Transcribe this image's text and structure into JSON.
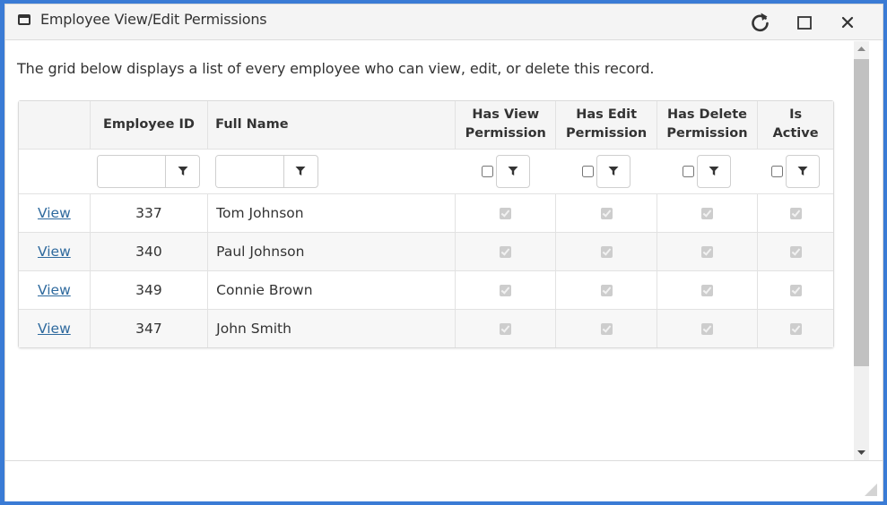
{
  "window": {
    "title": "Employee View/Edit Permissions",
    "icon": "window-icon",
    "controls": {
      "refresh": "refresh-icon",
      "maximize": "maximize-icon",
      "close": "close-icon"
    }
  },
  "intro_text": "The grid below displays a list of every employee who can view, edit, or delete this record.",
  "grid": {
    "columns": [
      {
        "key": "action",
        "label": ""
      },
      {
        "key": "employee_id",
        "label": "Employee ID"
      },
      {
        "key": "full_name",
        "label": "Full Name"
      },
      {
        "key": "has_view",
        "label_line1": "Has View",
        "label_line2": "Permission"
      },
      {
        "key": "has_edit",
        "label_line1": "Has Edit",
        "label_line2": "Permission"
      },
      {
        "key": "has_delete",
        "label_line1": "Has Delete",
        "label_line2": "Permission"
      },
      {
        "key": "is_active",
        "label": "Is Active"
      }
    ],
    "filters": {
      "employee_id": {
        "value": "",
        "placeholder": ""
      },
      "full_name": {
        "value": "",
        "placeholder": ""
      },
      "has_view": {
        "checked": false
      },
      "has_edit": {
        "checked": false
      },
      "has_delete": {
        "checked": false
      },
      "is_active": {
        "checked": false
      }
    },
    "rows": [
      {
        "action": "View",
        "employee_id": "337",
        "full_name": "Tom Johnson",
        "has_view": true,
        "has_edit": true,
        "has_delete": true,
        "is_active": true
      },
      {
        "action": "View",
        "employee_id": "340",
        "full_name": "Paul Johnson",
        "has_view": true,
        "has_edit": true,
        "has_delete": true,
        "is_active": true
      },
      {
        "action": "View",
        "employee_id": "349",
        "full_name": "Connie Brown",
        "has_view": true,
        "has_edit": true,
        "has_delete": true,
        "is_active": true
      },
      {
        "action": "View",
        "employee_id": "347",
        "full_name": "John Smith",
        "has_view": true,
        "has_edit": true,
        "has_delete": true,
        "is_active": true
      }
    ]
  },
  "colors": {
    "frame": "#3a7bd5",
    "link": "#2f6a9e",
    "header_bg": "#f5f5f5",
    "alt_row_bg": "#f7f7f7"
  }
}
